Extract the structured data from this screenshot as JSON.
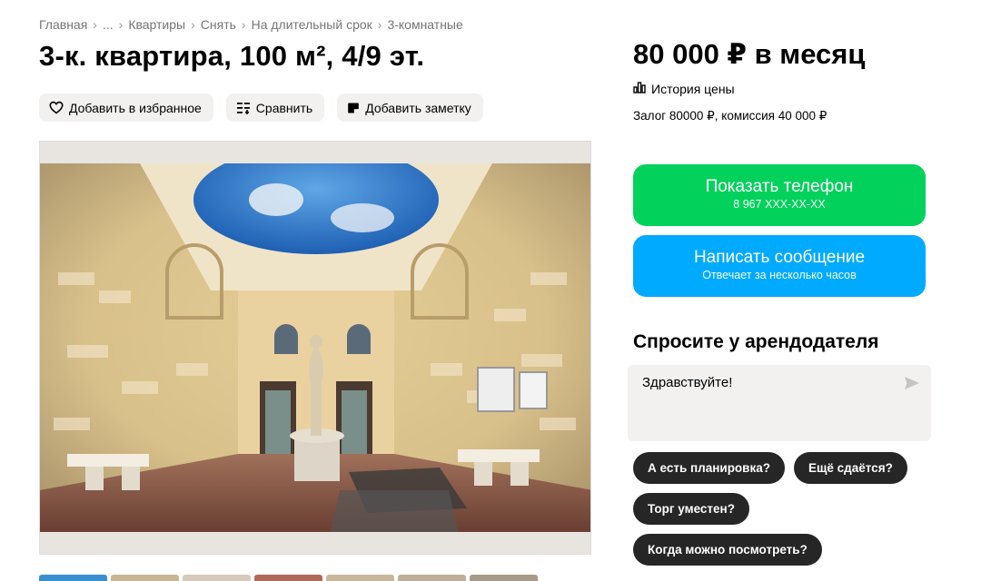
{
  "breadcrumb": [
    "Главная",
    "...",
    "Квартиры",
    "Снять",
    "На длительный срок",
    "3-комнатные"
  ],
  "title": "3-к. квартира, 100 м², 4/9 эт.",
  "actions": {
    "favorite": "Добавить в избранное",
    "compare": "Сравнить",
    "note": "Добавить заметку"
  },
  "photo": {
    "description_icon": "listing-photo"
  },
  "thumbnails": [
    {
      "color": "#3a8fd0"
    },
    {
      "color": "#c8b594"
    },
    {
      "color": "#d7c9bb"
    },
    {
      "color": "#b06a5a"
    },
    {
      "color": "#c9b79c"
    },
    {
      "color": "#bfae9a"
    },
    {
      "color": "#a89a88"
    }
  ],
  "price": "80 000 ₽ в месяц",
  "price_history": "История цены",
  "deposit": "Залог 80000 ₽, комиссия 40 000 ₽",
  "show_phone": {
    "label": "Показать телефон",
    "phone": "8 967 XXX-XX-XX",
    "color": "#02d15c"
  },
  "send_message": {
    "label": "Написать сообщение",
    "sub": "Отвечает за несколько часов",
    "color": "#00aaff"
  },
  "ask": {
    "title": "Спросите у арендодателя",
    "message": "Здравствуйте!"
  },
  "chips": [
    "А есть планировка?",
    "Ещё сдаётся?",
    "Торг уместен?",
    "Когда можно посмотреть?"
  ]
}
